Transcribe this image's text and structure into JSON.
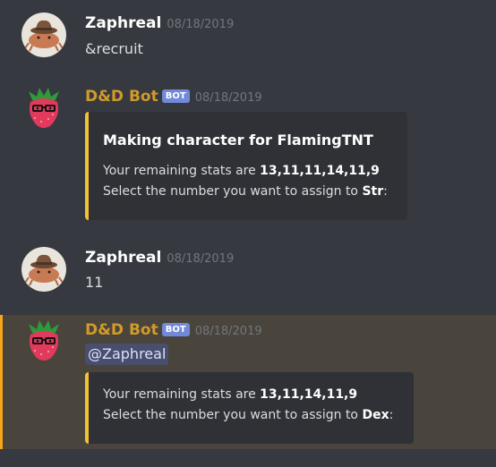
{
  "messages": [
    {
      "author": "Zaphreal",
      "timestamp": "08/18/2019",
      "text": "&recruit",
      "avatar_icon": "cowboy-hat-crab-avatar"
    },
    {
      "author": "D&D Bot",
      "bot_tag": "BOT",
      "timestamp": "08/18/2019",
      "avatar_icon": "strawberry-with-glasses-avatar",
      "embed": {
        "title": "Making character for FlamingTNT",
        "line1_prefix": "Your remaining stats are ",
        "line1_value": "13,11,11,14,11,9",
        "line2_prefix": "Select the number you want to assign to ",
        "line2_value": "Str",
        "line2_suffix": ":",
        "accent_color": "#f2c231"
      }
    },
    {
      "author": "Zaphreal",
      "timestamp": "08/18/2019",
      "text": "11",
      "avatar_icon": "cowboy-hat-crab-avatar"
    },
    {
      "author": "D&D Bot",
      "bot_tag": "BOT",
      "timestamp": "08/18/2019",
      "avatar_icon": "strawberry-with-glasses-avatar",
      "mention": "@Zaphreal",
      "embed": {
        "line1_prefix": "Your remaining stats are ",
        "line1_value": "13,11,14,11,9",
        "line2_prefix": "Select the number you want to assign to ",
        "line2_value": "Dex",
        "line2_suffix": ":",
        "accent_color": "#f2c231"
      }
    }
  ],
  "colors": {
    "background": "#36393f",
    "embed_background": "#2f3136",
    "bot_name": "#d19a2a",
    "bot_tag": "#7289da",
    "mention_highlight": "#49443c",
    "mention_bar": "#faa61a"
  }
}
